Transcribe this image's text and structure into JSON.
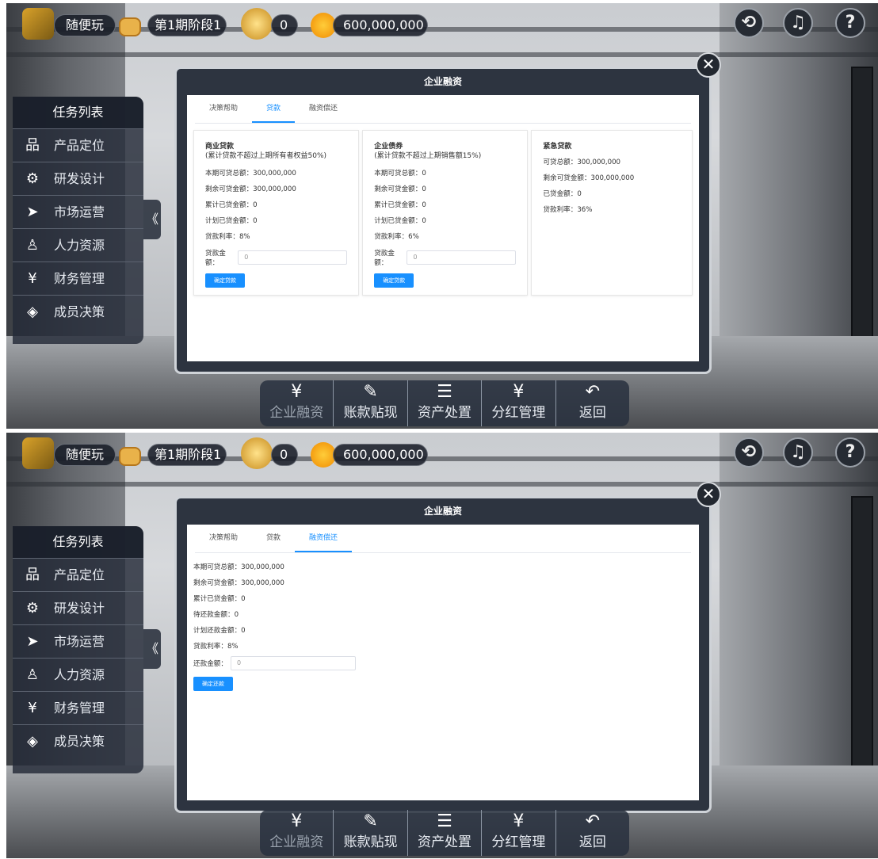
{
  "top_bar": {
    "player": "随便玩",
    "period": "第1期阶段1",
    "trophies": "0",
    "money": "600,000,000"
  },
  "top_right": {
    "history": "history-icon",
    "notifications": "bell-icon",
    "help": "?"
  },
  "sidebar": {
    "title": "任务列表",
    "items": [
      {
        "label": "产品定位",
        "icon": "品"
      },
      {
        "label": "研发设计",
        "icon": "⚙"
      },
      {
        "label": "市场运营",
        "icon": "➤"
      },
      {
        "label": "人力资源",
        "icon": "♙"
      },
      {
        "label": "财务管理",
        "icon": "¥"
      },
      {
        "label": "成员决策",
        "icon": "◈"
      }
    ],
    "collapse": "《"
  },
  "modal": {
    "title": "企业融资",
    "close": "✕",
    "tabs": [
      "决策帮助",
      "贷款",
      "融资偿还"
    ]
  },
  "panel1": {
    "active_tab": "贷款",
    "cards": [
      {
        "title": "商业贷款",
        "subtitle": "(累计贷款不超过上期所有者权益50%)",
        "rows": [
          "本期可贷总额：300,000,000",
          "剩余可贷金额：300,000,000",
          "累计已贷金额：0",
          "计划已贷金额：0",
          "贷款利率：8%"
        ],
        "input_label": "贷款金额：",
        "input_value": "0",
        "button": "确定贷款"
      },
      {
        "title": "企业债券",
        "subtitle": "(累计贷款不超过上期销售额15%)",
        "rows": [
          "本期可贷总额：0",
          "剩余可贷金额：0",
          "累计已贷金额：0",
          "计划已贷金额：0",
          "贷款利率：6%"
        ],
        "input_label": "贷款金额：",
        "input_value": "0",
        "button": "确定贷款"
      },
      {
        "title": "紧急贷款",
        "rows": [
          "可贷总额：300,000,000",
          "剩余可贷金额：300,000,000",
          "已贷金额：0",
          "贷款利率：36%"
        ]
      }
    ]
  },
  "panel2": {
    "active_tab": "融资偿还",
    "rows": [
      "本期可贷总额：300,000,000",
      "剩余可贷金额：300,000,000",
      "累计已贷金额：0",
      "待还款金额：0",
      "计划还款金额：0",
      "贷款利率：8%"
    ],
    "input_label": "还款金额：",
    "input_value": "0",
    "button": "确定还款"
  },
  "bottom_menu": [
    {
      "label": "企业融资",
      "icon": "¥"
    },
    {
      "label": "账款贴现",
      "icon": "✎"
    },
    {
      "label": "资产处置",
      "icon": "☰"
    },
    {
      "label": "分红管理",
      "icon": "¥"
    },
    {
      "label": "返回",
      "icon": "↶"
    }
  ]
}
